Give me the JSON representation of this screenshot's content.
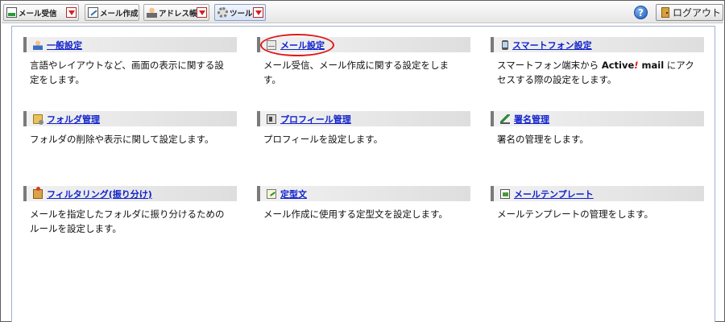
{
  "toolbar": {
    "buttons": [
      {
        "label": "メール受信",
        "icon": "inbox-icon"
      },
      {
        "label": "メール作成",
        "icon": "compose-icon"
      },
      {
        "label": "アドレス帳",
        "icon": "address-book-icon"
      },
      {
        "label": "ツール",
        "icon": "gear-icon"
      }
    ],
    "help_label": "?",
    "logout_label": "ログアウト"
  },
  "tools": [
    {
      "title": "一般設定",
      "icon": "user-settings-icon",
      "desc": "言語やレイアウトなど、画面の表示に関する設定をします。"
    },
    {
      "title": "メール設定",
      "icon": "mail-settings-icon",
      "desc": "メール受信、メール作成に関する設定をします。"
    },
    {
      "title": "スマートフォン設定",
      "icon": "smartphone-icon",
      "desc_pre": "スマートフォン端末から ",
      "brand_a": "Active",
      "brand_b": "!",
      "brand_c": " mail",
      "desc_post": " にアクセスする際の設定をします。"
    },
    {
      "title": "フォルダ管理",
      "icon": "folder-icon",
      "desc": "フォルダの削除や表示に関して設定します。"
    },
    {
      "title": "プロフィール管理",
      "icon": "profile-icon",
      "desc": "プロフィールを設定します。"
    },
    {
      "title": "署名管理",
      "icon": "signature-icon",
      "desc": "署名の管理をします。"
    },
    {
      "title": "フィルタリング(振り分け)",
      "icon": "filter-icon",
      "desc": "メールを指定したフォルダに振り分けるためのルールを設定します。"
    },
    {
      "title": "定型文",
      "icon": "template-icon",
      "desc": "メール作成に使用する定型文を設定します。"
    },
    {
      "title": "メールテンプレート",
      "icon": "mail-template-icon",
      "desc": "メールテンプレートの管理をします。"
    }
  ],
  "colors": {
    "link": "#1122cc",
    "highlight": "#e01818",
    "brand_accent": "#e01818"
  }
}
